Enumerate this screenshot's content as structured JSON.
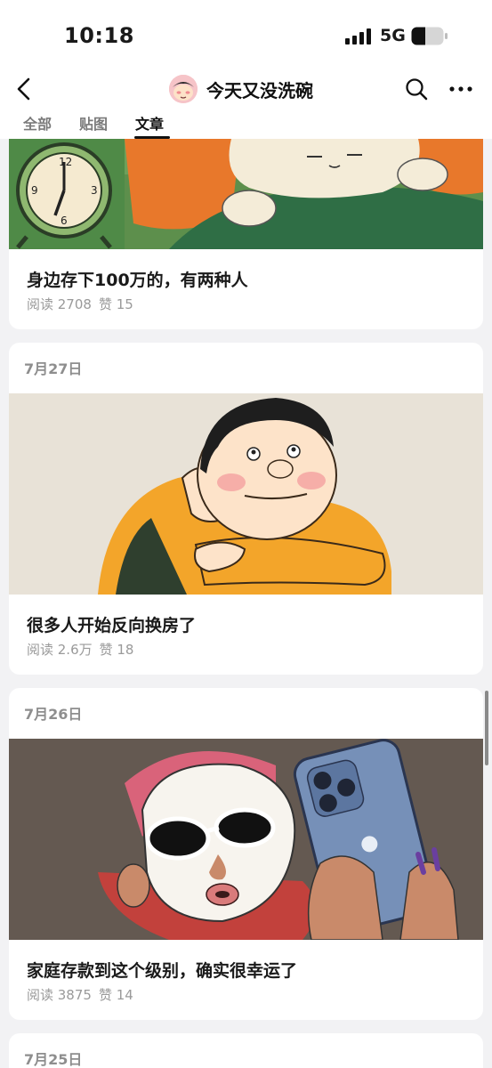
{
  "status_bar": {
    "time": "10:18",
    "network": "5G"
  },
  "header": {
    "title": "今天又没洗碗"
  },
  "tabs": [
    {
      "label": "全部"
    },
    {
      "label": "贴图"
    },
    {
      "label": "文章"
    }
  ],
  "active_tab": "文章",
  "articles": [
    {
      "date": "",
      "title": "身边存下100万的，有两种人",
      "reads": "阅读 2708",
      "likes": "赞 15"
    },
    {
      "date": "7月27日",
      "title": "很多人开始反向换房了",
      "reads": "阅读 2.6万",
      "likes": "赞 18"
    },
    {
      "date": "7月26日",
      "title": "家庭存款到这个级别，确实很幸运了",
      "reads": "阅读 3875",
      "likes": "赞 14"
    },
    {
      "date": "7月25日"
    }
  ],
  "icons": [
    "back-icon",
    "search-icon",
    "more-icon",
    "signal-icon",
    "battery-icon"
  ],
  "colors": {
    "background": "#f2f2f4",
    "card": "#ffffff",
    "muted_text": "#9a9a9a"
  }
}
